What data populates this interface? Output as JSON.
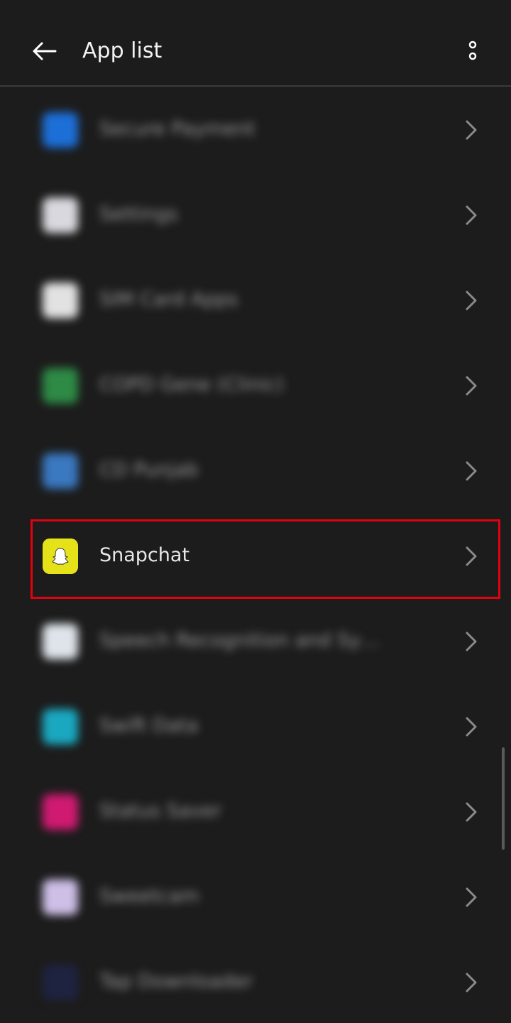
{
  "app_bar": {
    "title": "App list",
    "back_icon": "arrow-left-icon",
    "menu_icon": "more-vertical-icon"
  },
  "apps": [
    {
      "label": "Secure Payment",
      "icon_color": "#1d6fd8",
      "blurred": true
    },
    {
      "label": "Settings",
      "icon_color": "#d8d8de",
      "blurred": true
    },
    {
      "label": "SIM Card Apps",
      "icon_color": "#e2e2e2",
      "blurred": true
    },
    {
      "label": "COPD Gene (Clinic)",
      "icon_color": "#2e8a45",
      "blurred": true
    },
    {
      "label": "CD Punjab",
      "icon_color": "#3a78c0",
      "blurred": true
    },
    {
      "label": "Snapchat",
      "icon_color": "#e6e21a",
      "blurred": false
    },
    {
      "label": "Speech Recognition and Synthe...",
      "icon_color": "#dfe4ea",
      "blurred": true
    },
    {
      "label": "Swift Data",
      "icon_color": "#1aa8c0",
      "blurred": true
    },
    {
      "label": "Status Saver",
      "icon_color": "#d01a72",
      "blurred": true
    },
    {
      "label": "Sweetcam",
      "icon_color": "#cdbfe6",
      "blurred": true
    },
    {
      "label": "Tap Downloader",
      "icon_color": "#1e2340",
      "blurred": true
    }
  ],
  "highlight_color": "#e3000f"
}
